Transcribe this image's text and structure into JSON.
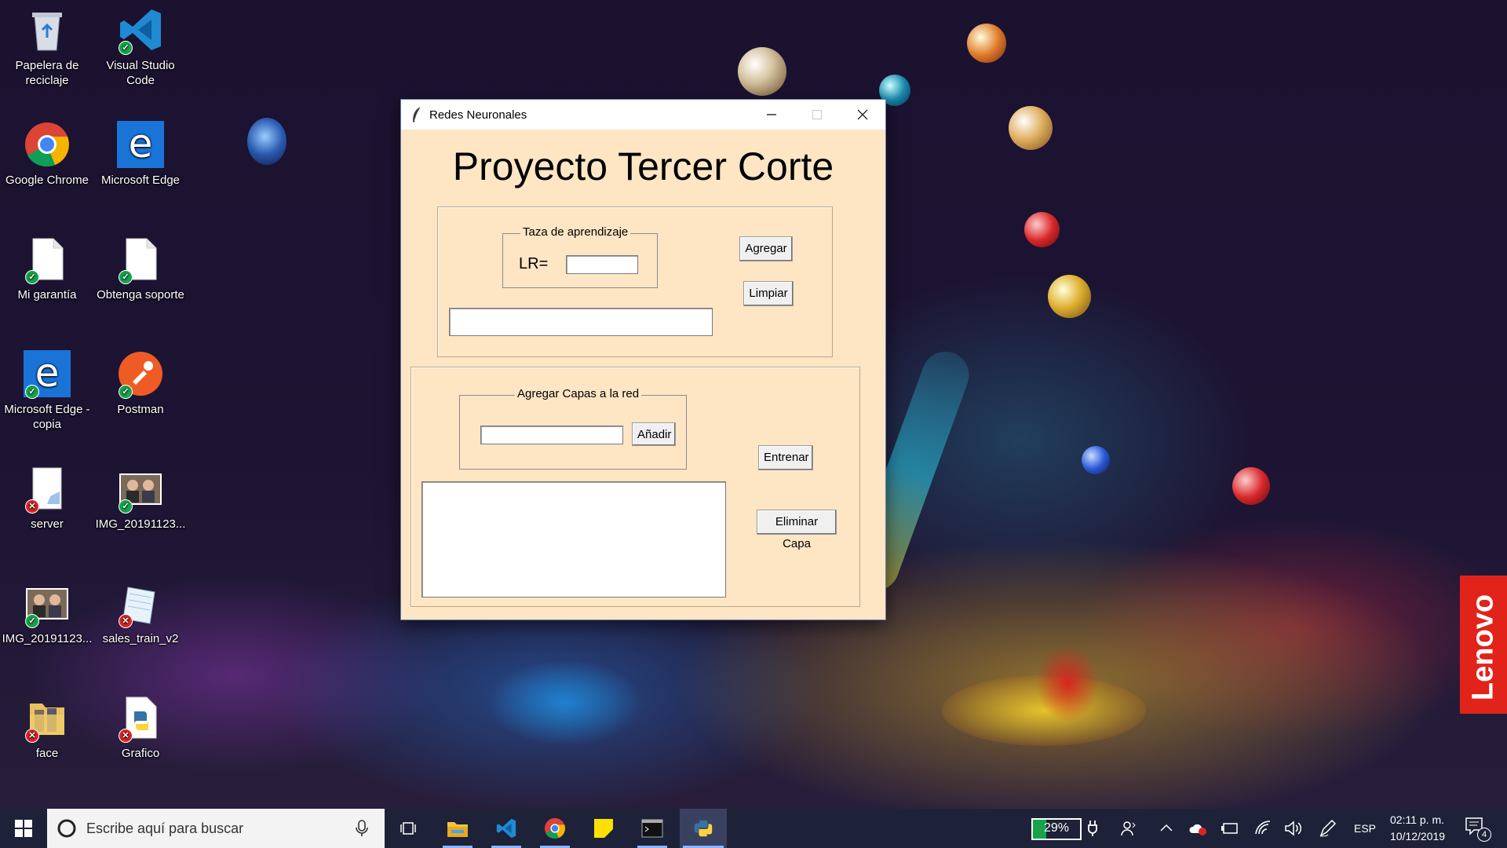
{
  "desktop": {
    "icons": [
      {
        "label": "Papelera de reciclaje",
        "icon": "recycle-bin-icon"
      },
      {
        "label": "Visual Studio Code",
        "icon": "vscode-icon"
      },
      {
        "label": "Google Chrome",
        "icon": "chrome-icon"
      },
      {
        "label": "Microsoft Edge",
        "icon": "edge-icon"
      },
      {
        "label": "Mi garantía",
        "icon": "document-icon"
      },
      {
        "label": "Obtenga soporte",
        "icon": "document-icon"
      },
      {
        "label": "Microsoft Edge - copia",
        "icon": "edge-icon"
      },
      {
        "label": "Postman",
        "icon": "postman-icon"
      },
      {
        "label": "server",
        "icon": "text-file-icon"
      },
      {
        "label": "IMG_20191123...",
        "icon": "photo-icon"
      },
      {
        "label": "IMG_20191123...",
        "icon": "photo-icon"
      },
      {
        "label": "sales_train_v2",
        "icon": "notepad-icon"
      },
      {
        "label": "face",
        "icon": "folder-icon"
      },
      {
        "label": "Grafico",
        "icon": "python-file-icon"
      }
    ],
    "brand_tag": "Lenovo"
  },
  "window": {
    "title": "Redes Neuronales",
    "heading": "Proyecto Tercer Corte",
    "lr_group": {
      "label": "Taza de aprendizaje",
      "lr_label": "LR=",
      "lr_value": "",
      "add_button": "Agregar",
      "clear_button": "Limpiar",
      "output_value": ""
    },
    "layers_group": {
      "label": "Agregar Capas a la red",
      "layer_value": "",
      "add_button": "Añadir",
      "train_button": "Entrenar",
      "delete_button": "Eliminar Capa"
    }
  },
  "taskbar": {
    "search_placeholder": "Escribe aquí para buscar",
    "battery": "29%",
    "language": "ESP",
    "time": "02:11 p. m.",
    "date": "10/12/2019",
    "notifications": "4"
  },
  "colors": {
    "window_bg": "#fee5c4",
    "taskbar_bg": "#1d2238",
    "lenovo": "#e2231a"
  }
}
